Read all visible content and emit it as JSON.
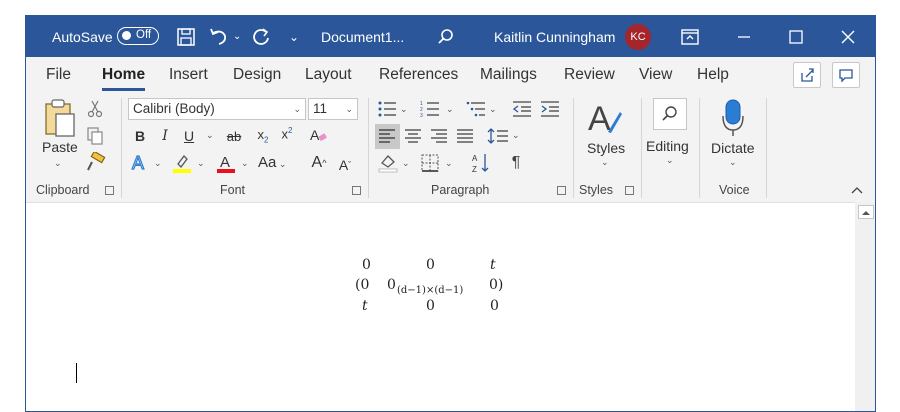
{
  "titlebar": {
    "autosave_label": "AutoSave",
    "autosave_state": "Off",
    "document_name": "Document1...",
    "user_name": "Kaitlin Cunningham",
    "user_initials": "KC",
    "accent_color": "#2b579a",
    "avatar_color": "#a4262c"
  },
  "tabs": [
    "File",
    "Home",
    "Insert",
    "Design",
    "Layout",
    "References",
    "Mailings",
    "Review",
    "View",
    "Help"
  ],
  "active_tab": "Home",
  "ribbon": {
    "clipboard": {
      "paste_label": "Paste",
      "group_label": "Clipboard"
    },
    "font": {
      "font_name": "Calibri (Body)",
      "font_size": "11",
      "group_label": "Font",
      "change_case": "Aa"
    },
    "paragraph": {
      "group_label": "Paragraph"
    },
    "styles": {
      "label": "Styles",
      "group_label": "Styles"
    },
    "editing": {
      "label": "Editing"
    },
    "voice": {
      "dictate_label": "Dictate",
      "group_label": "Voice"
    }
  },
  "document": {
    "matrix": {
      "row1": [
        "0",
        "0",
        "t"
      ],
      "row2_open": "(0",
      "row2_mid": "0",
      "row2_sub": "(d−1)×(d−1)",
      "row2_close": "0)",
      "row3": [
        "t",
        "0",
        "0"
      ]
    }
  }
}
